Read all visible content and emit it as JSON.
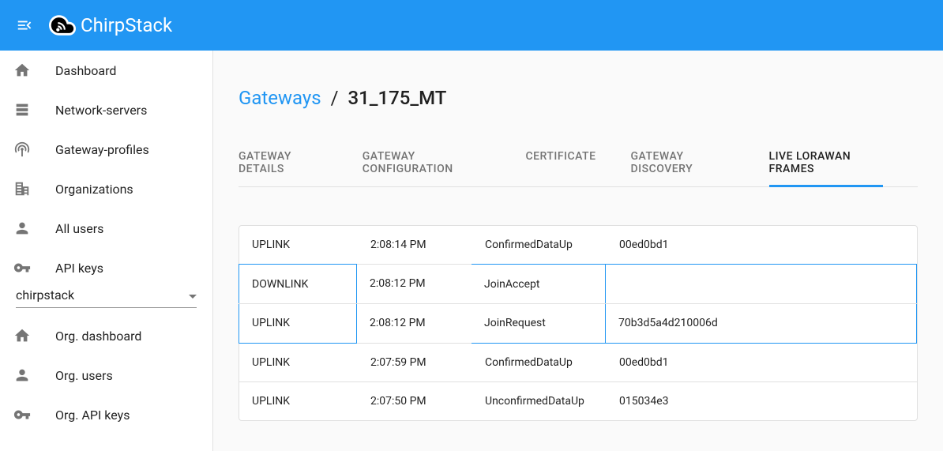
{
  "header": {
    "brand": "ChirpStack"
  },
  "sidebar": {
    "top_items": [
      {
        "label": "Dashboard",
        "icon": "home-icon"
      },
      {
        "label": "Network-servers",
        "icon": "server-icon"
      },
      {
        "label": "Gateway-profiles",
        "icon": "antenna-icon"
      },
      {
        "label": "Organizations",
        "icon": "building-icon"
      },
      {
        "label": "All users",
        "icon": "person-icon"
      },
      {
        "label": "API keys",
        "icon": "key-icon"
      }
    ],
    "org_selector": "chirpstack",
    "bottom_items": [
      {
        "label": "Org. dashboard",
        "icon": "home-icon"
      },
      {
        "label": "Org. users",
        "icon": "person-icon"
      },
      {
        "label": "Org. API keys",
        "icon": "key-icon"
      }
    ]
  },
  "breadcrumb": {
    "link": "Gateways",
    "sep": "/",
    "current": "31_175_MT"
  },
  "tabs": [
    {
      "label": "GATEWAY DETAILS",
      "active": false
    },
    {
      "label": "GATEWAY CONFIGURATION",
      "active": false
    },
    {
      "label": "CERTIFICATE",
      "active": false
    },
    {
      "label": "GATEWAY DISCOVERY",
      "active": false
    },
    {
      "label": "LIVE LORAWAN FRAMES",
      "active": true
    }
  ],
  "frames": [
    {
      "direction": "UPLINK",
      "time": "2:08:14 PM",
      "type": "ConfirmedDataUp",
      "addr": "00ed0bd1",
      "hl": false
    },
    {
      "direction": "DOWNLINK",
      "time": "2:08:12 PM",
      "type": "JoinAccept",
      "addr": "",
      "hl": true,
      "first_hl": true
    },
    {
      "direction": "UPLINK",
      "time": "2:08:12 PM",
      "type": "JoinRequest",
      "addr": "70b3d5a4d210006d",
      "hl": true,
      "last_hl": true
    },
    {
      "direction": "UPLINK",
      "time": "2:07:59 PM",
      "type": "ConfirmedDataUp",
      "addr": "00ed0bd1",
      "hl": false
    },
    {
      "direction": "UPLINK",
      "time": "2:07:50 PM",
      "type": "UnconfirmedDataUp",
      "addr": "015034e3",
      "hl": false
    }
  ]
}
